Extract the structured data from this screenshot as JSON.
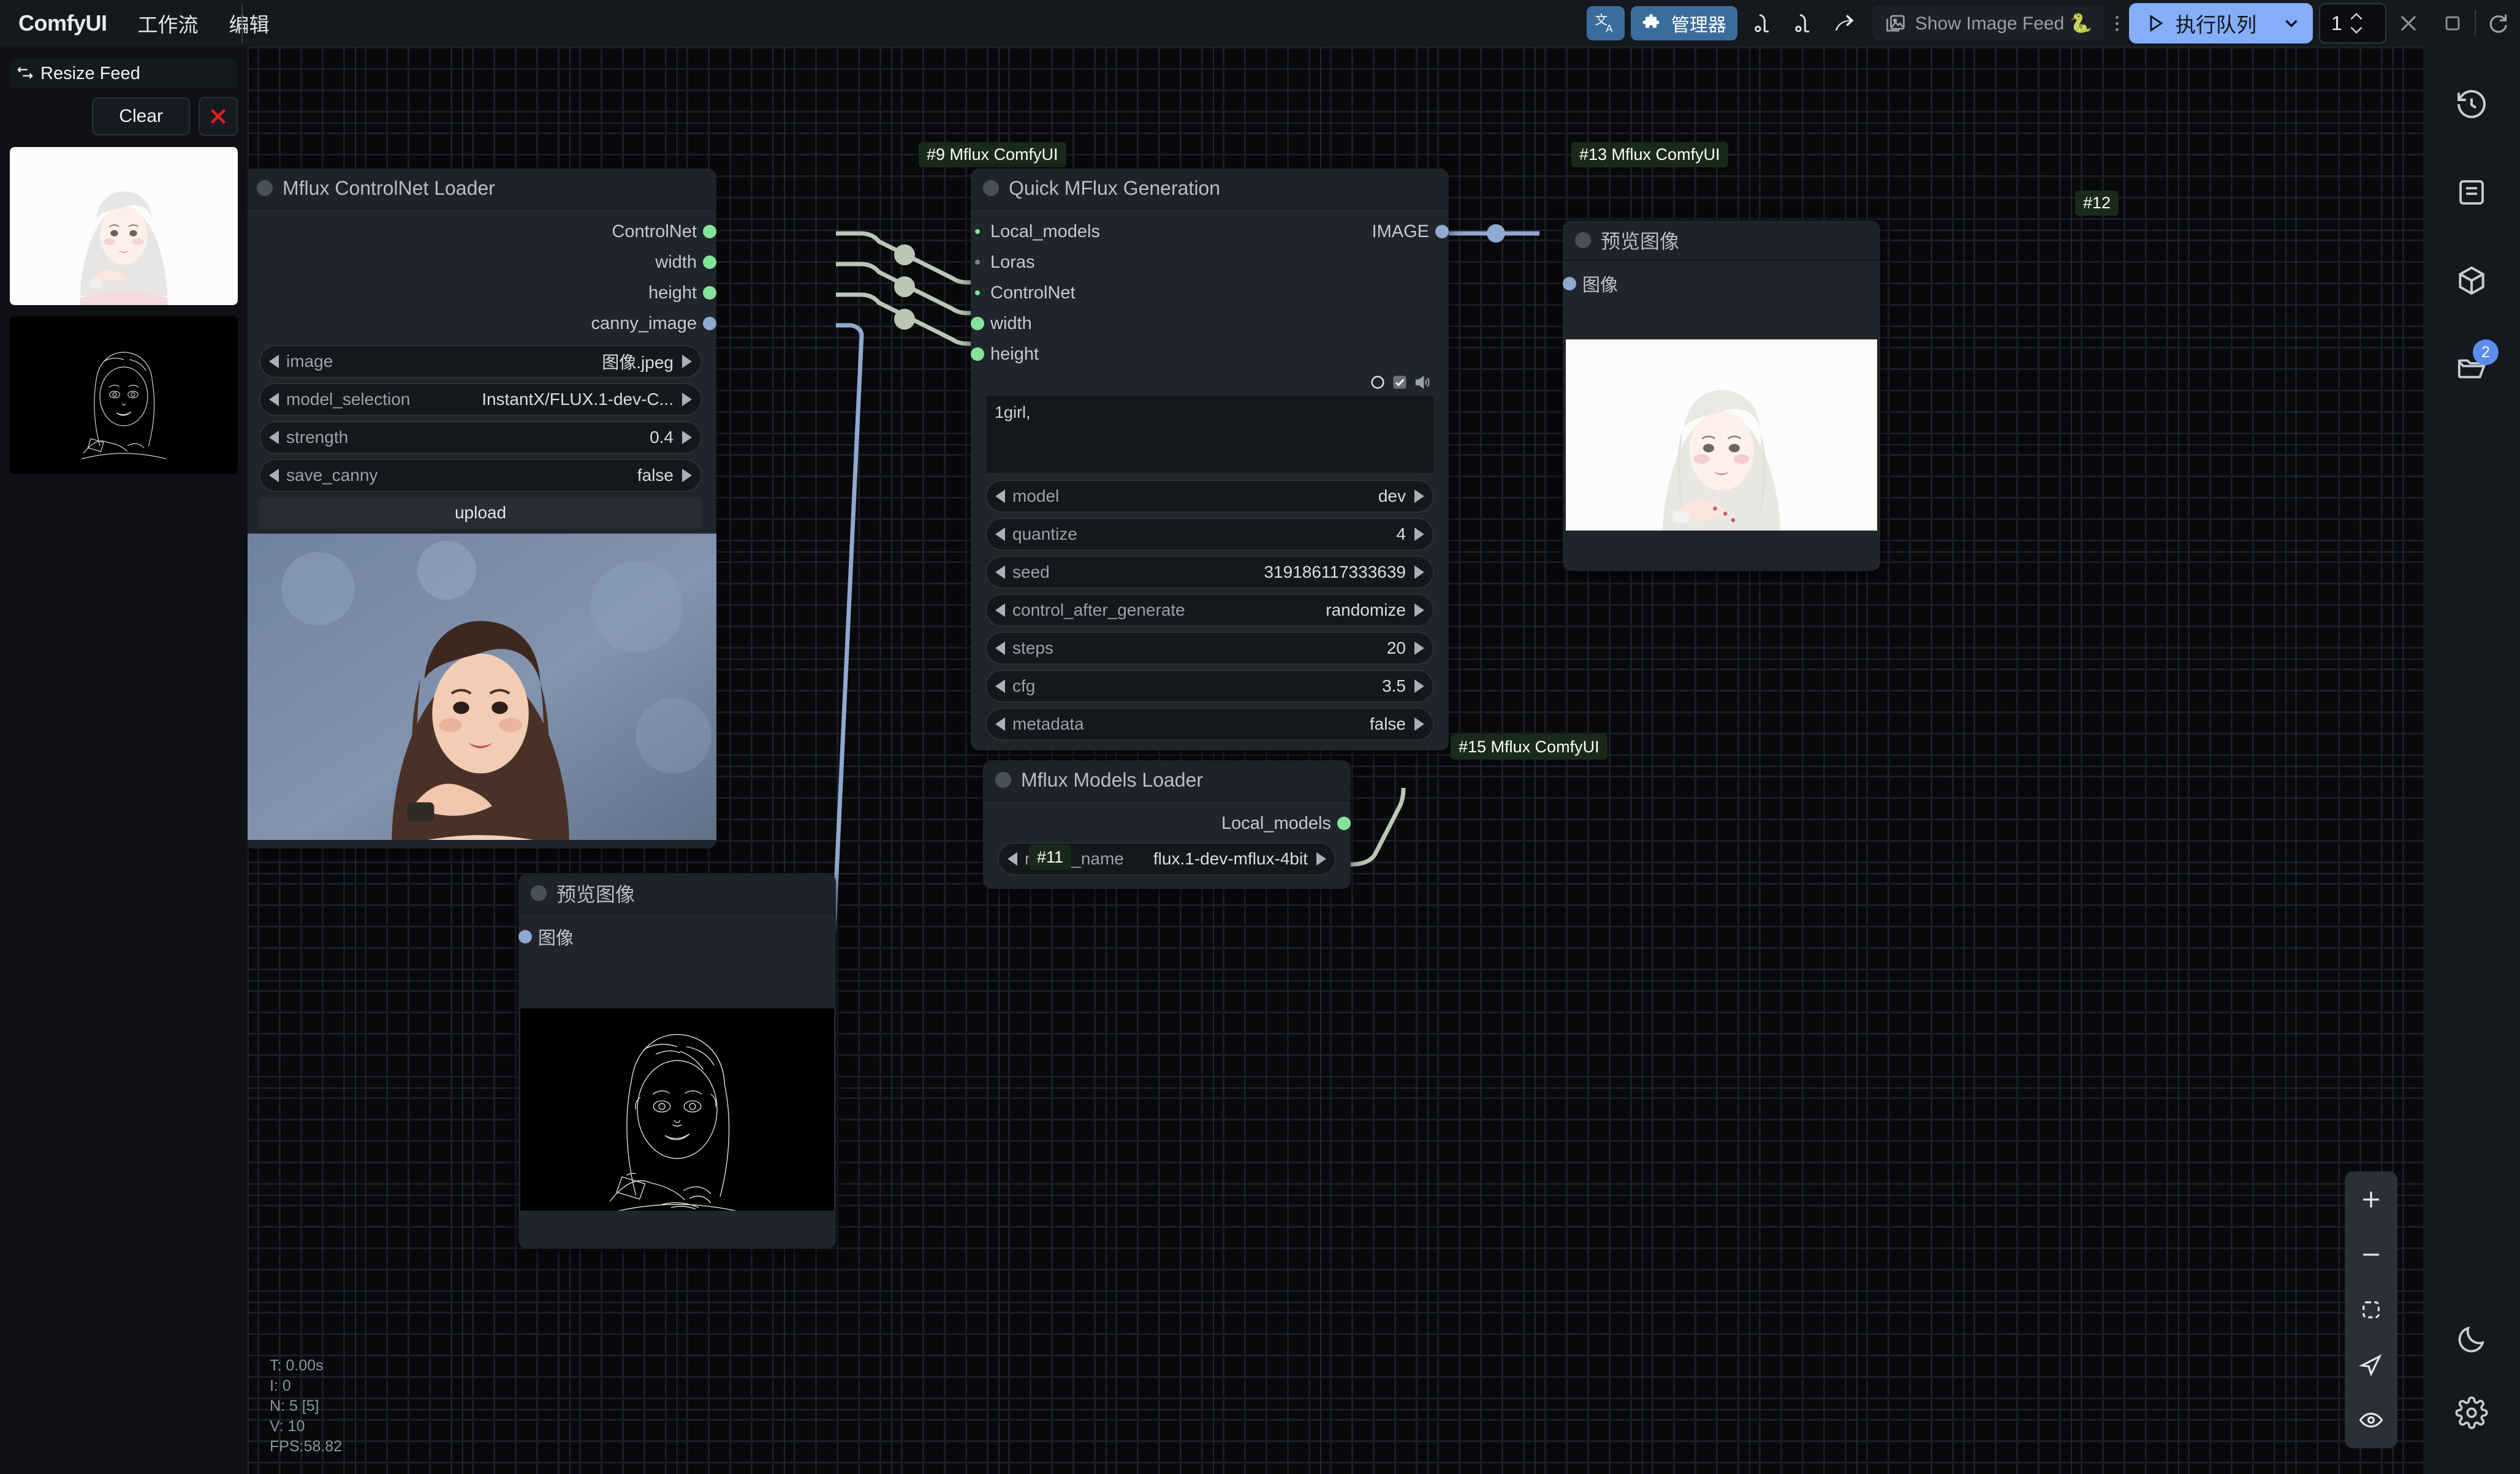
{
  "app": {
    "brand": "ComfyUI",
    "menu": [
      "工作流",
      "编辑"
    ]
  },
  "toolbar": {
    "translate_icon": "translate-icon",
    "manager_label": "管理器",
    "manager_icon": "puzzle-icon",
    "vacuum_icon": "vacuum-icon",
    "vacuum2_icon": "vacuum-icon",
    "share_icon": "share-arrow-icon",
    "feed_label": "Show Image Feed 🐍",
    "feed_icon": "image-stack-icon",
    "kebab_icon": "kebab-menu-icon",
    "queue_label": "执行队列",
    "queue_play_icon": "play-icon",
    "queue_caret_icon": "chevron-down-icon",
    "batch_value": "1",
    "spinner_up_icon": "chevron-up-icon",
    "spinner_down_icon": "chevron-down-icon",
    "close_icon": "close-x-icon",
    "stop_icon": "stop-square-icon",
    "refresh_icon": "refresh-icon"
  },
  "feed_panel": {
    "resize_label": "Resize Feed",
    "resize_icon": "resize-horizontal-icon",
    "clear_label": "Clear",
    "close_icon": "close-x-red-icon",
    "thumbnails": [
      {
        "name": "generated-portrait-thumb"
      },
      {
        "name": "canny-edge-thumb"
      }
    ]
  },
  "right_rail": {
    "items": [
      {
        "name": "queue-history-icon",
        "badge": null
      },
      {
        "name": "node-library-icon",
        "badge": null
      },
      {
        "name": "model-library-icon",
        "badge": null
      },
      {
        "name": "workflows-folder-icon",
        "badge": "2"
      }
    ],
    "bottom": [
      {
        "name": "theme-toggle-moon-icon"
      },
      {
        "name": "settings-gear-icon"
      }
    ]
  },
  "zoom_controls": {
    "zoom_in_icon": "plus-icon",
    "zoom_out_icon": "minus-icon",
    "fit_view_icon": "fit-frame-icon",
    "pan_icon": "cursor-arrow-icon",
    "toggle_links_icon": "eye-icon"
  },
  "stats": {
    "lines": [
      "T: 0.00s",
      "I: 0",
      "N: 5 [5]",
      "V: 10",
      "FPS:58.82"
    ]
  },
  "nodes": {
    "controlnet_loader": {
      "badge": "#9 Mflux ComfyUI",
      "title": "Mflux ControlNet Loader",
      "outputs": [
        {
          "label": "ControlNet",
          "dot": "green"
        },
        {
          "label": "width",
          "dot": "green"
        },
        {
          "label": "height",
          "dot": "green"
        },
        {
          "label": "canny_image",
          "dot": "blue"
        }
      ],
      "widgets": [
        {
          "label": "image",
          "value": "图像.jpeg"
        },
        {
          "label": "model_selection",
          "value": "InstantX/FLUX.1-dev-C..."
        },
        {
          "label": "strength",
          "value": "0.4"
        },
        {
          "label": "save_canny",
          "value": "false"
        }
      ],
      "button": "upload",
      "image_name": "source-portrait-preview"
    },
    "quick_mflux": {
      "badge": "#13 Mflux ComfyUI",
      "title": "Quick MFlux Generation",
      "inputs": [
        {
          "label": "Local_models",
          "dot": "ring"
        },
        {
          "label": "Loras",
          "dot": "ring-gray"
        },
        {
          "label": "ControlNet",
          "dot": "ring"
        },
        {
          "label": "width",
          "dot": "green"
        },
        {
          "label": "height",
          "dot": "green"
        }
      ],
      "outputs": [
        {
          "label": "IMAGE",
          "dot": "blue"
        }
      ],
      "prompt": "1girl,",
      "prompt_icons": [
        "circle-o-icon",
        "checkbox-checked-icon",
        "speaker-icon"
      ],
      "widgets": [
        {
          "label": "model",
          "value": "dev"
        },
        {
          "label": "quantize",
          "value": "4"
        },
        {
          "label": "seed",
          "value": "319186117333639"
        },
        {
          "label": "control_after_generate",
          "value": "randomize"
        },
        {
          "label": "steps",
          "value": "20"
        },
        {
          "label": "cfg",
          "value": "3.5"
        },
        {
          "label": "metadata",
          "value": "false"
        }
      ]
    },
    "models_loader": {
      "badge": "#15 Mflux ComfyUI",
      "title": "Mflux Models Loader",
      "outputs": [
        {
          "label": "Local_models",
          "dot": "green"
        }
      ],
      "widgets": [
        {
          "label": "model_name",
          "value": "flux.1-dev-mflux-4bit"
        }
      ]
    },
    "preview_right": {
      "badge": "#12",
      "title": "预览图像",
      "inputs": [
        {
          "label": "图像",
          "dot": "blue"
        }
      ],
      "image_name": "generated-portrait-preview"
    },
    "preview_bottom": {
      "badge": "#11",
      "title": "预览图像",
      "inputs": [
        {
          "label": "图像",
          "dot": "blue"
        }
      ],
      "image_name": "canny-edge-preview"
    }
  },
  "colors": {
    "accent_blue": "#84aef7",
    "manager_blue": "#3b6d9c",
    "port_green": "#84e29a",
    "port_blue": "#8fa9d0",
    "badge_green_bg": "#1a2a1a",
    "link_wire": "#bcc6b5",
    "red_close": "#e02020"
  }
}
